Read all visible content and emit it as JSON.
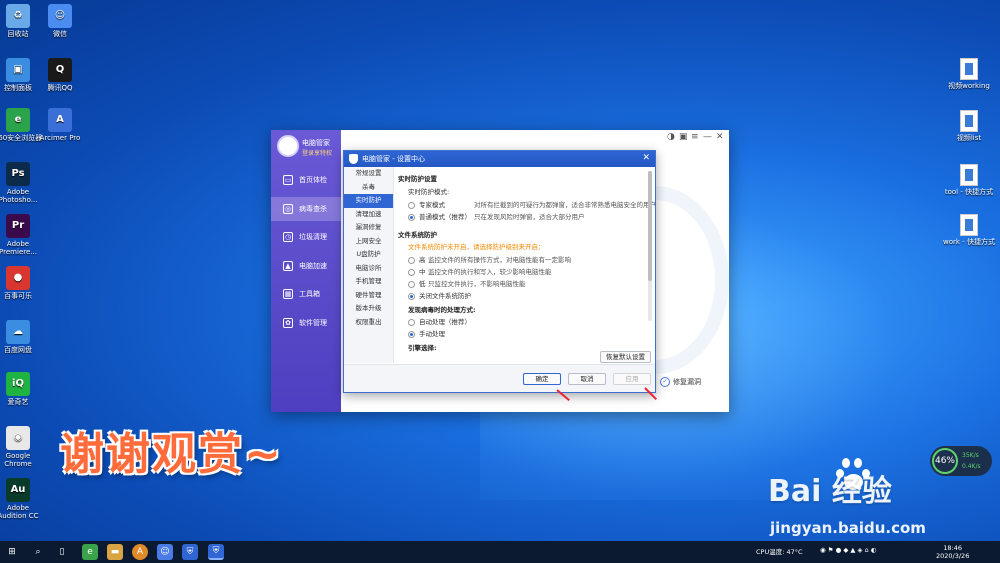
{
  "desktop": {
    "left_icons": [
      {
        "label": "回收站",
        "color": "#6aa9e8",
        "glyph": "♻"
      },
      {
        "label": "微信",
        "color": "#4a8cf0",
        "glyph": "☺"
      },
      {
        "label": "控制面板",
        "color": "#3a8de0",
        "glyph": "▣"
      },
      {
        "label": "腾讯QQ",
        "color": "#1a1a1a",
        "glyph": "Q"
      },
      {
        "label": "360安全浏览器",
        "color": "#2aa34a",
        "glyph": "e"
      },
      {
        "label": "Arcimer Pro",
        "color": "#3a6fd8",
        "glyph": "A"
      },
      {
        "label": "Adobe Photosho...",
        "color": "#0c2a4a",
        "glyph": "Ps"
      },
      {
        "label": "Adobe Premiere...",
        "color": "#3b0a4a",
        "glyph": "Pr"
      },
      {
        "label": "百事可乐",
        "color": "#d8362f",
        "glyph": "●"
      },
      {
        "label": "百度网盘",
        "color": "#3a8de0",
        "glyph": "☁"
      },
      {
        "label": "爱奇艺",
        "color": "#1fb341",
        "glyph": "iQ"
      },
      {
        "label": "Google Chrome",
        "color": "#e8e8e8",
        "glyph": "◉"
      },
      {
        "label": "Adobe Audition CC",
        "color": "#0a3a2a",
        "glyph": "Au"
      }
    ],
    "right_icons": [
      {
        "label": "视频working"
      },
      {
        "label": "视频list"
      },
      {
        "label": "tool - 快捷方式"
      },
      {
        "label": "work - 快捷方式"
      }
    ],
    "overlay_text": "谢谢观赏~"
  },
  "app": {
    "brand": "电脑管家",
    "brand_sub": "登录享特权",
    "nav": [
      {
        "label": "首页体检",
        "glyph": "▭"
      },
      {
        "label": "病毒查杀",
        "glyph": "◎"
      },
      {
        "label": "垃圾清理",
        "glyph": "◷"
      },
      {
        "label": "电脑加速",
        "glyph": "▲"
      },
      {
        "label": "工具箱",
        "glyph": "▦"
      },
      {
        "label": "软件管理",
        "glyph": "✿"
      }
    ],
    "restore_label": "修复漏洞"
  },
  "dialog": {
    "title": "电脑管家 - 设置中心",
    "menu": [
      "常规设置",
      "杀毒",
      "实时防护",
      "清理加速",
      "漏洞修复",
      "上网安全",
      "U盘防护",
      "电脑诊所",
      "手机管理",
      "硬件管理",
      "版本升级",
      "权限重出"
    ],
    "active_menu_index": 2,
    "section_realtime": "实时防护设置",
    "mode_label": "实时防护模式:",
    "modes": [
      {
        "name": "专家模式",
        "desc": "对所有拦截到的可疑行为都弹窗，适合非常熟悉电脑安全的用户",
        "selected": false
      },
      {
        "name": "普通模式（推荐）",
        "desc": "只在发现风险时弹窗，适合大部分用户",
        "selected": true
      }
    ],
    "section_file": "文件系统防护",
    "file_warning": "文件系统防护未开启，请选择防护级别来开启：",
    "levels": [
      {
        "name": "高",
        "desc": "监控文件的所有操作方式，对电脑性能有一定影响",
        "selected": false
      },
      {
        "name": "中",
        "desc": "监控文件的执行和写入，较少影响电脑性能",
        "selected": false
      },
      {
        "name": "低",
        "desc": "只监控文件执行，不影响电脑性能",
        "selected": false
      },
      {
        "name": "关闭文件系统防护",
        "desc": "",
        "selected": true
      }
    ],
    "virus_label": "发现病毒时的处理方式:",
    "virus_options": [
      {
        "name": "自动处理（推荐）",
        "selected": false
      },
      {
        "name": "手动处理",
        "selected": true
      }
    ],
    "engine_label": "引擎选择:",
    "restore_defaults": "恢复默认设置",
    "ok": "确定",
    "cancel": "取消",
    "apply": "应用"
  },
  "widget": {
    "percent": "46%",
    "up": "35K/s",
    "down": "0.4K/s"
  },
  "watermark": {
    "brand": "Bai  经验",
    "url": "jingyan.baidu.com"
  },
  "taskbar": {
    "cpu_temp": "CPU温度: 47°C",
    "time": "18:46",
    "date": "2020/3/26"
  }
}
